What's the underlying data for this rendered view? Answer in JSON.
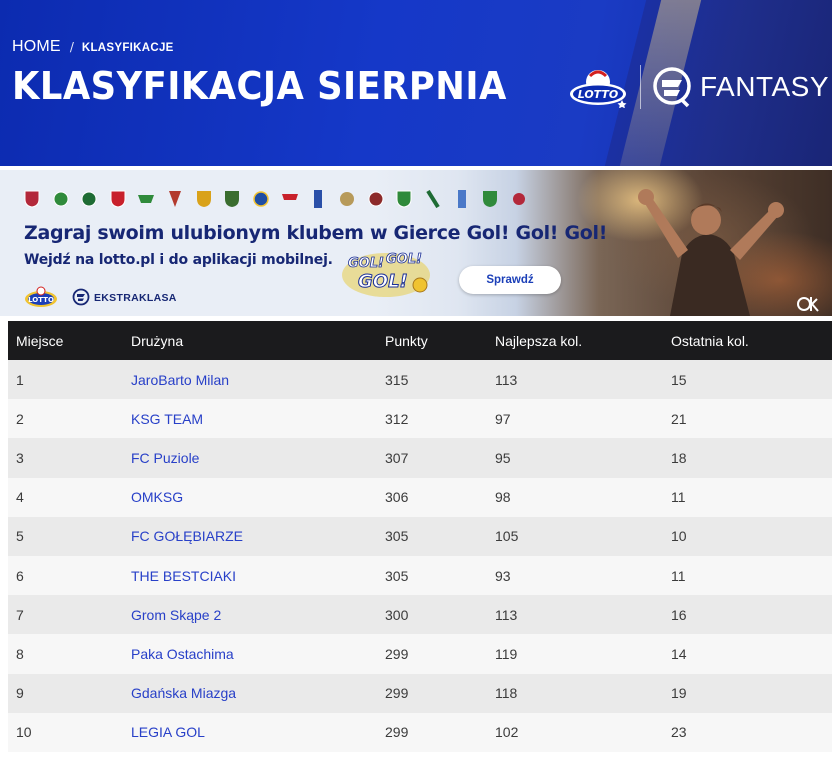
{
  "breadcrumb": {
    "home": "HOME",
    "separator": "/",
    "current": "KLASYFIKACJE"
  },
  "page_title": "KLASYFIKACJA SIERPNIA",
  "logos": {
    "lotto_icon": "lotto-logo",
    "ekstraklasa_icon": "ekstraklasa-logo",
    "fantasy_label": "FANTASY"
  },
  "banner": {
    "headline": "Zagraj swoim ulubionym klubem w Gierce Gol! Gol! Gol!",
    "subline": "Wejdź na lotto.pl i do aplikacji mobilnej.",
    "button_label": "Sprawdź",
    "ekstraklasa_label": "EKSTRAKLASA",
    "game_logo_text": [
      "GOL!",
      "GOL!",
      "GOL!"
    ],
    "badge_colors": [
      "#b3283a",
      "#2f8a3b",
      "#1e6b34",
      "#c8202b",
      "#2f8a3b",
      "#b33a2e",
      "#d9a21a",
      "#3a6d2f",
      "#1f4da3",
      "#c8202b",
      "#2a4fa8",
      "#b79a5a",
      "#8c2a2a",
      "#2f8a3b",
      "#1e6b34",
      "#4a78c8",
      "#2f8a3b",
      "#b3283a"
    ]
  },
  "colors": {
    "header_bg": "#1538c8",
    "title_text": "#ffffff",
    "table_header_bg": "#1b1b1d",
    "team_link": "#2840c8",
    "banner_text": "#172774"
  },
  "table": {
    "columns": [
      "Miejsce",
      "Drużyna",
      "Punkty",
      "Najlepsza kol.",
      "Ostatnia kol."
    ],
    "rows": [
      {
        "place": "1",
        "team": "JaroBarto Milan",
        "points": "315",
        "best": "113",
        "last": "15"
      },
      {
        "place": "2",
        "team": "KSG TEAM",
        "points": "312",
        "best": "97",
        "last": "21"
      },
      {
        "place": "3",
        "team": "FC Puziole",
        "points": "307",
        "best": "95",
        "last": "18"
      },
      {
        "place": "4",
        "team": "OMKSG",
        "points": "306",
        "best": "98",
        "last": "11"
      },
      {
        "place": "5",
        "team": "FC GOŁĘBIARZE",
        "points": "305",
        "best": "105",
        "last": "10"
      },
      {
        "place": "6",
        "team": "THE BESTCIAKI",
        "points": "305",
        "best": "93",
        "last": "11"
      },
      {
        "place": "7",
        "team": "Grom Skąpe 2",
        "points": "300",
        "best": "113",
        "last": "16"
      },
      {
        "place": "8",
        "team": "Paka Ostachima",
        "points": "299",
        "best": "119",
        "last": "14"
      },
      {
        "place": "9",
        "team": "Gdańska Miazga",
        "points": "299",
        "best": "118",
        "last": "19"
      },
      {
        "place": "10",
        "team": "LEGIA GOL",
        "points": "299",
        "best": "102",
        "last": "23"
      }
    ]
  }
}
